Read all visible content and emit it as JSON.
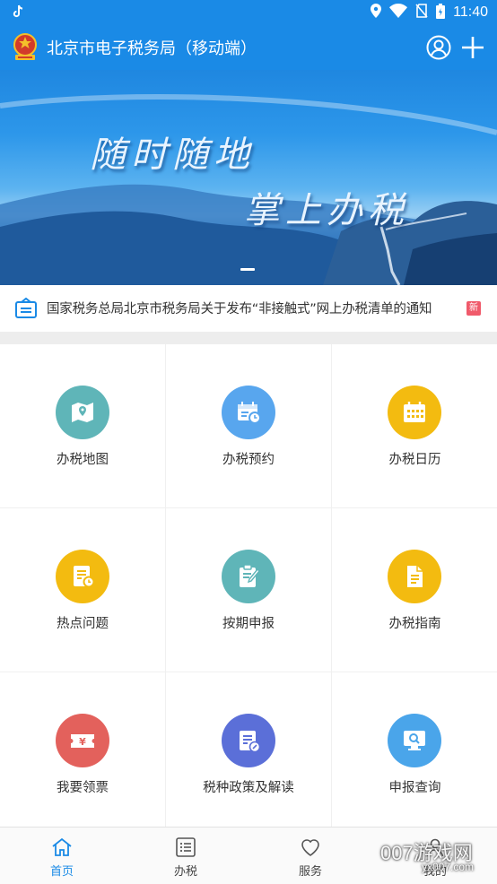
{
  "status_bar": {
    "time": "11:40",
    "left_icon": "tiktok-icon",
    "icons": [
      "location-icon",
      "wifi-icon",
      "no-sim-icon",
      "battery-icon"
    ]
  },
  "app_bar": {
    "title": "北京市电子税务局（移动端）",
    "emblem": "tax-emblem-icon",
    "actions": [
      "user-icon",
      "plus-icon"
    ]
  },
  "banner": {
    "line1": "随时随地",
    "line2": "掌上办税",
    "slide_count_indicator": "1"
  },
  "notice": {
    "text": "国家税务总局北京市税务局关于发布“非接触式”网上办税清单的通知",
    "badge": "新"
  },
  "colors": {
    "primary": "#1a8ae6",
    "teal": "#4fb5b7",
    "blue": "#4a9ef0",
    "yellow": "#f3bb10",
    "red": "#e3615c",
    "indigo": "#5b6fd8",
    "sky": "#4aa5ea"
  },
  "grid": [
    {
      "label": "办税地图",
      "icon": "map-icon",
      "color": "#5fb5b8"
    },
    {
      "label": "办税预约",
      "icon": "calendar-clock-icon",
      "color": "#58a6ee"
    },
    {
      "label": "办税日历",
      "icon": "calendar-icon",
      "color": "#f3bb10"
    },
    {
      "label": "热点问题",
      "icon": "document-clock-icon",
      "color": "#f3bb10"
    },
    {
      "label": "按期申报",
      "icon": "clipboard-edit-icon",
      "color": "#5fb5b8"
    },
    {
      "label": "办税指南",
      "icon": "document-icon",
      "color": "#f3bb10"
    },
    {
      "label": "我要领票",
      "icon": "ticket-icon",
      "color": "#e3615c"
    },
    {
      "label": "税种政策及解读",
      "icon": "policy-edit-icon",
      "color": "#5b6fd8"
    },
    {
      "label": "申报查询",
      "icon": "monitor-search-icon",
      "color": "#4aa5ea"
    }
  ],
  "tabs": [
    {
      "label": "首页",
      "icon": "home-icon",
      "active": true
    },
    {
      "label": "办税",
      "icon": "list-icon",
      "active": false
    },
    {
      "label": "服务",
      "icon": "heart-icon",
      "active": false
    },
    {
      "label": "我的",
      "icon": "person-icon",
      "active": false
    }
  ],
  "watermark": {
    "line1": "007游戏网",
    "line2": "yx007.com"
  }
}
